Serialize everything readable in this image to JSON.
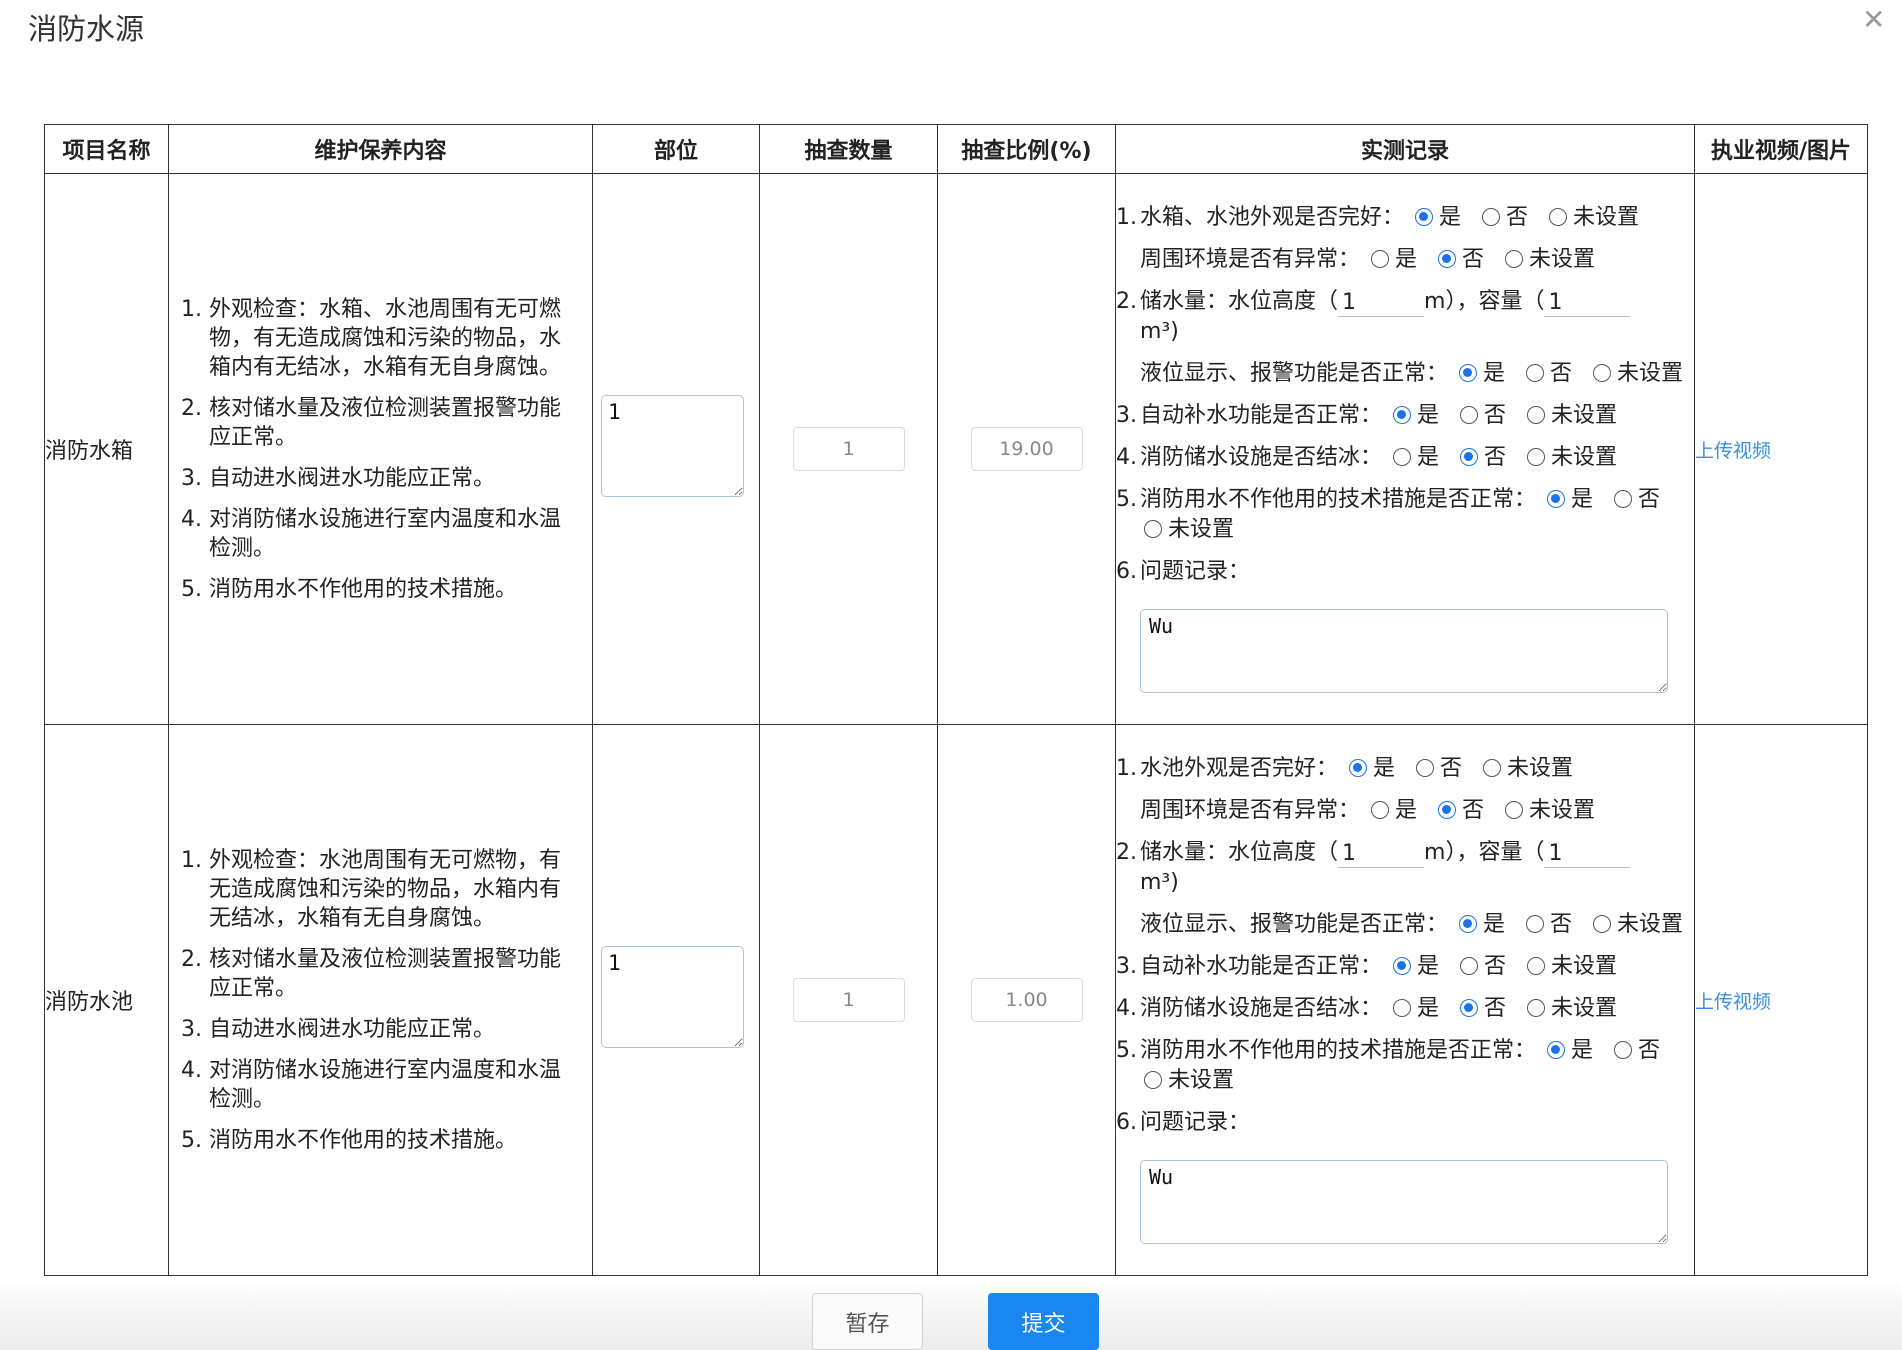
{
  "dialog": {
    "title": "消防水源",
    "close_icon": "close-icon"
  },
  "table": {
    "headers": [
      "项目名称",
      "维护保养内容",
      "部位",
      "抽查数量",
      "抽查比例(%)",
      "实测记录",
      "执业视频/图片"
    ],
    "rows": [
      {
        "name": "消防水箱",
        "content": [
          "外观检查：水箱、水池周围有无可燃物，有无造成腐蚀和污染的物品，水箱内有无结冰，水箱有无自身腐蚀。",
          "核对储水量及液位检测装置报警功能应正常。",
          "自动进水阀进水功能应正常。",
          "对消防储水设施进行室内温度和水温检测。",
          "消防用水不作他用的技术措施。"
        ],
        "location": "1",
        "sample_qty": "1",
        "sample_ratio": "19.00",
        "record": {
          "q1": "水箱、水池外观是否完好：",
          "q1_sub": "周围环境是否有异常：",
          "q2_prefix": "储水量：水位高度（",
          "water_height": "1",
          "q2_mid": "m），容量（",
          "capacity": "1",
          "q2_unit": "m³)",
          "q2_sub": "液位显示、报警功能是否正常：",
          "q3": "自动补水功能是否正常：",
          "q4": "消防储水设施是否结冰：",
          "q5": "消防用水不作他用的技术措施是否正常：",
          "q6": "问题记录：",
          "problem_text": "Wu"
        },
        "upload_label": "上传视频"
      },
      {
        "name": "消防水池",
        "content": [
          "外观检查：水池周围有无可燃物，有无造成腐蚀和污染的物品，水箱内有无结冰，水箱有无自身腐蚀。",
          "核对储水量及液位检测装置报警功能应正常。",
          "自动进水阀进水功能应正常。",
          "对消防储水设施进行室内温度和水温检测。",
          "消防用水不作他用的技术措施。"
        ],
        "location": "1",
        "sample_qty": "1",
        "sample_ratio": "1.00",
        "record": {
          "q1": "水池外观是否完好：",
          "q1_sub": "周围环境是否有异常：",
          "q2_prefix": "储水量：水位高度（",
          "water_height": "1",
          "q2_mid": "m），容量（",
          "capacity": "1",
          "q2_unit": "m³)",
          "q2_sub": "液位显示、报警功能是否正常：",
          "q3": "自动补水功能是否正常：",
          "q4": "消防储水设施是否结冰：",
          "q5": "消防用水不作他用的技术措施是否正常：",
          "q6": "问题记录：",
          "problem_text": "Wu"
        },
        "upload_label": "上传视频"
      }
    ]
  },
  "options": {
    "yes": "是",
    "no": "否",
    "unset": "未设置"
  },
  "selections": {
    "row0": {
      "q1": "yes",
      "q1_sub": "no",
      "q2_sub": "yes",
      "q3": "yes",
      "q4": "no",
      "q5": "yes"
    },
    "row1": {
      "q1": "yes",
      "q1_sub": "no",
      "q2_sub": "yes",
      "q3": "yes",
      "q4": "no",
      "q5": "yes"
    }
  },
  "footer": {
    "save_label": "暂存",
    "submit_label": "提交"
  },
  "colors": {
    "accent": "#1a87f0",
    "link": "#3a8ee6",
    "radio_checked": "#1a73e8"
  }
}
